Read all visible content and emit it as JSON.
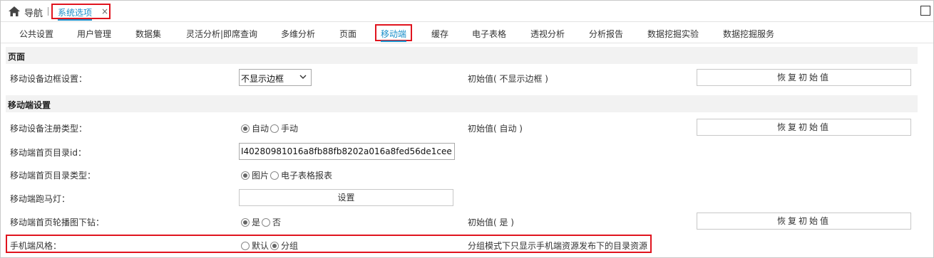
{
  "topbar": {
    "nav_label": "导航",
    "active_tab": "系统选项",
    "close_glyph": "×"
  },
  "subtabs": [
    "公共设置",
    "用户管理",
    "数据集",
    "灵活分析|即席查询",
    "多维分析",
    "页面",
    "移动端",
    "缓存",
    "电子表格",
    "透视分析",
    "分析报告",
    "数据挖掘实验",
    "数据挖掘服务"
  ],
  "sections": {
    "page": "页面",
    "mobile": "移动端设置"
  },
  "rows": {
    "border": {
      "label": "移动设备边框设置：",
      "select_value": "不显示边框",
      "init": "初始值( 不显示边框 )",
      "reset": "恢复初始值"
    },
    "reg_type": {
      "label": "移动设备注册类型：",
      "opt1": "自动",
      "opt2": "手动",
      "init": "初始值( 自动 )",
      "reset": "恢复初始值"
    },
    "home_id": {
      "label": "移动端首页目录id：",
      "value": "I40280981016a8fb88fb8202a016a8fed56de1cee"
    },
    "home_type": {
      "label": "移动端首页目录类型：",
      "opt1": "图片",
      "opt2": "电子表格报表"
    },
    "marquee": {
      "label": "移动端跑马灯：",
      "button": "设置"
    },
    "drill": {
      "label": "移动端首页轮播图下钻：",
      "opt1": "是",
      "opt2": "否",
      "init": "初始值( 是 )",
      "reset": "恢复初始值"
    },
    "style": {
      "label": "手机端风格：",
      "opt1": "默认",
      "opt2": "分组",
      "note": "分组模式下只显示手机端资源发布下的目录资源"
    }
  },
  "colors": {
    "accent": "#1a8ec9",
    "highlight": "#e0141e",
    "section_bg": "#f2f2f2"
  },
  "icons": {
    "home": "home-icon",
    "maximize": "maximize-icon",
    "chevron": "chevron-down-icon"
  }
}
